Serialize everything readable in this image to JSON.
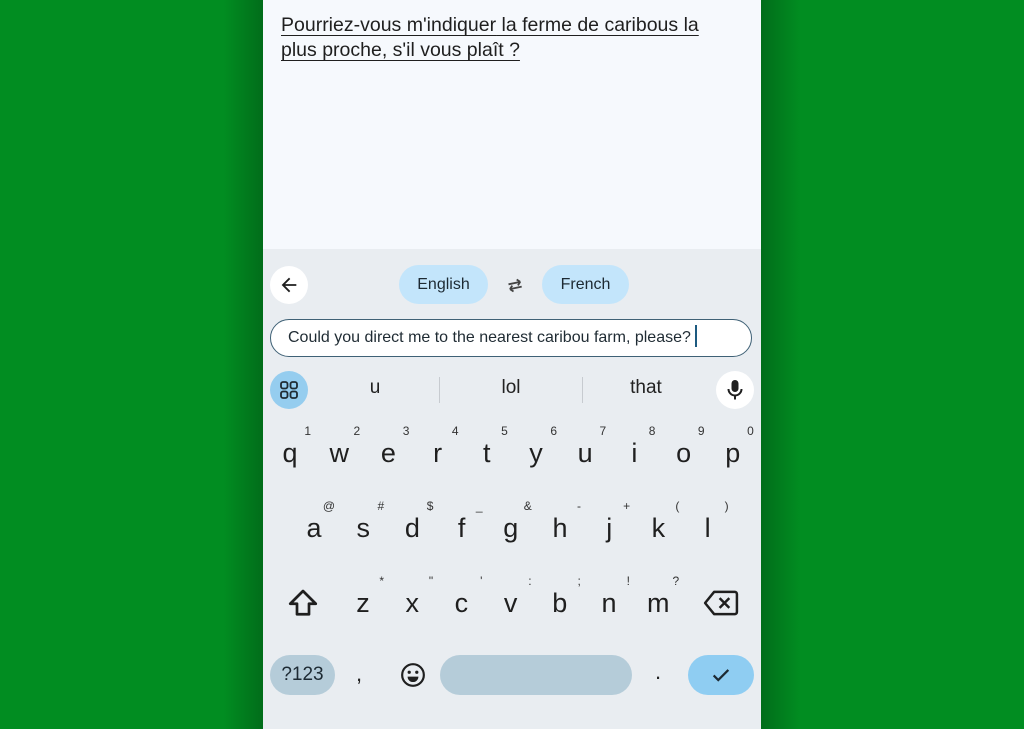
{
  "document": {
    "line1_part1": "Pourriez-vous m'indiquer",
    "line1_part2": " la ferme de caribous la",
    "line2": "plus proche, s'il vous plaît ?"
  },
  "translate_bar": {
    "back_icon": "arrow-left-icon",
    "source_language": "English",
    "swap_icon": "swap-arrows-icon",
    "target_language": "French"
  },
  "input": {
    "value": "Could you direct me to the nearest caribou farm, please?"
  },
  "suggestions": {
    "apps_icon": "grid-icon",
    "items": [
      "u",
      "lol",
      "that"
    ],
    "mic_icon": "microphone-icon"
  },
  "keyboard": {
    "row1": [
      {
        "key": "q",
        "hint": "1"
      },
      {
        "key": "w",
        "hint": "2"
      },
      {
        "key": "e",
        "hint": "3"
      },
      {
        "key": "r",
        "hint": "4"
      },
      {
        "key": "t",
        "hint": "5"
      },
      {
        "key": "y",
        "hint": "6"
      },
      {
        "key": "u",
        "hint": "7"
      },
      {
        "key": "i",
        "hint": "8"
      },
      {
        "key": "o",
        "hint": "9"
      },
      {
        "key": "p",
        "hint": "0"
      }
    ],
    "row2": [
      {
        "key": "a",
        "hint": "@"
      },
      {
        "key": "s",
        "hint": "#"
      },
      {
        "key": "d",
        "hint": "$"
      },
      {
        "key": "f",
        "hint": "_"
      },
      {
        "key": "g",
        "hint": "&"
      },
      {
        "key": "h",
        "hint": "-"
      },
      {
        "key": "j",
        "hint": "+"
      },
      {
        "key": "k",
        "hint": "("
      },
      {
        "key": "l",
        "hint": ")"
      }
    ],
    "row3": [
      {
        "key": "z",
        "hint": "*"
      },
      {
        "key": "x",
        "hint": "\""
      },
      {
        "key": "c",
        "hint": "'"
      },
      {
        "key": "v",
        "hint": ":"
      },
      {
        "key": "b",
        "hint": ";"
      },
      {
        "key": "n",
        "hint": "!"
      },
      {
        "key": "m",
        "hint": "?"
      }
    ],
    "shift_icon": "shift-icon",
    "delete_icon": "backspace-icon",
    "symbols_label": "?123",
    "comma_label": ",",
    "emoji_icon": "emoji-icon",
    "period_label": ".",
    "enter_icon": "checkmark-icon"
  }
}
